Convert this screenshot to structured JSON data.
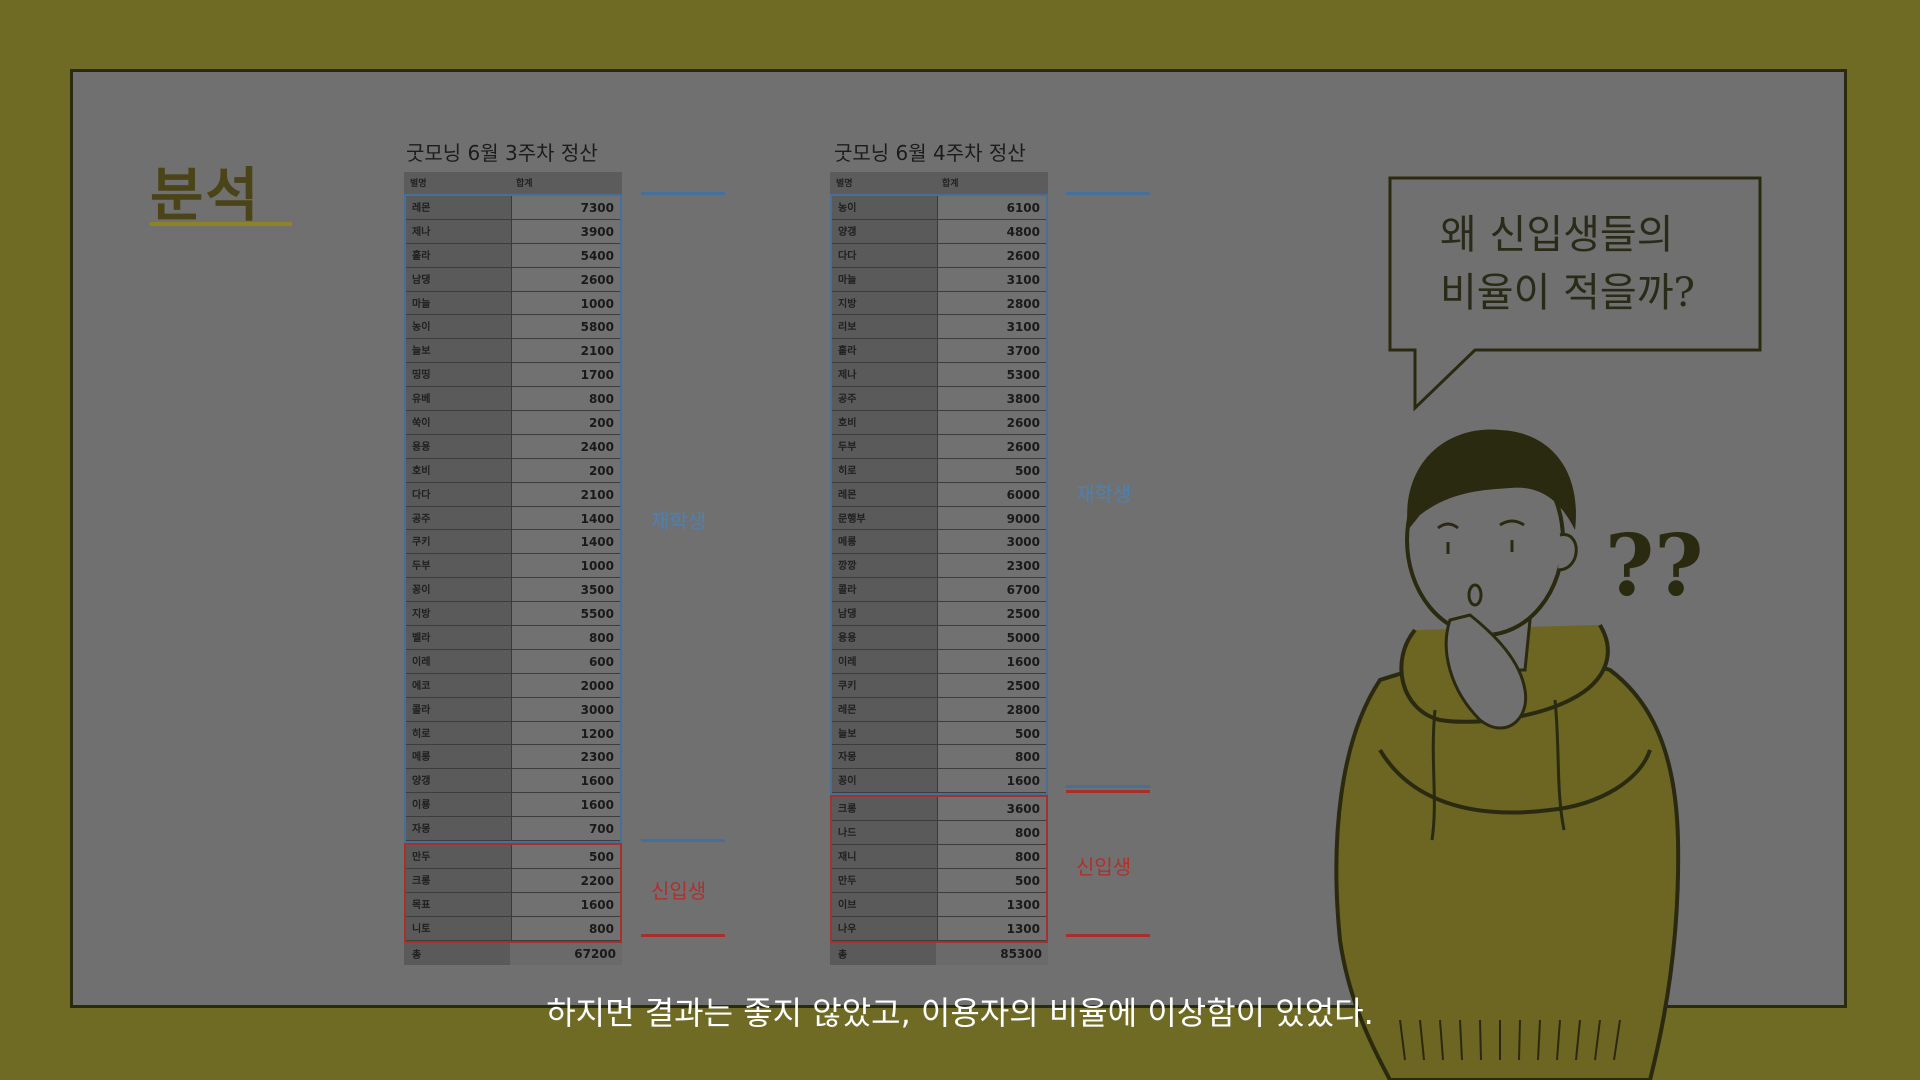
{
  "section_title": "분석",
  "tables": [
    {
      "title": "굿모닝 6월 3주차 정산",
      "header": {
        "name": "별명",
        "sum": "합계"
      },
      "returning": [
        {
          "name": "레몬",
          "value": "7300"
        },
        {
          "name": "제나",
          "value": "3900"
        },
        {
          "name": "홀라",
          "value": "5400"
        },
        {
          "name": "남댕",
          "value": "2600"
        },
        {
          "name": "마늘",
          "value": "1000"
        },
        {
          "name": "농이",
          "value": "5800"
        },
        {
          "name": "늘보",
          "value": "2100"
        },
        {
          "name": "띵띵",
          "value": "1700"
        },
        {
          "name": "유베",
          "value": "800"
        },
        {
          "name": "쑥이",
          "value": "200"
        },
        {
          "name": "용용",
          "value": "2400"
        },
        {
          "name": "호비",
          "value": "200"
        },
        {
          "name": "다다",
          "value": "2100"
        },
        {
          "name": "공주",
          "value": "1400"
        },
        {
          "name": "쿠키",
          "value": "1400"
        },
        {
          "name": "두부",
          "value": "1000"
        },
        {
          "name": "꽁이",
          "value": "3500"
        },
        {
          "name": "지방",
          "value": "5500"
        },
        {
          "name": "벨라",
          "value": "800"
        },
        {
          "name": "이레",
          "value": "600"
        },
        {
          "name": "에코",
          "value": "2000"
        },
        {
          "name": "콜라",
          "value": "3000"
        },
        {
          "name": "히로",
          "value": "1200"
        },
        {
          "name": "메롱",
          "value": "2300"
        },
        {
          "name": "양갱",
          "value": "1600"
        },
        {
          "name": "이룡",
          "value": "1600"
        },
        {
          "name": "자몽",
          "value": "700"
        }
      ],
      "new": [
        {
          "name": "만두",
          "value": "500"
        },
        {
          "name": "크롱",
          "value": "2200"
        },
        {
          "name": "목표",
          "value": "1600"
        },
        {
          "name": "니토",
          "value": "800"
        }
      ],
      "total": {
        "name": "총",
        "value": "67200"
      }
    },
    {
      "title": "굿모닝 6월 4주차 정산",
      "header": {
        "name": "별명",
        "sum": "합계"
      },
      "returning": [
        {
          "name": "농이",
          "value": "6100"
        },
        {
          "name": "양갱",
          "value": "4800"
        },
        {
          "name": "다다",
          "value": "2600"
        },
        {
          "name": "마늘",
          "value": "3100"
        },
        {
          "name": "지방",
          "value": "2800"
        },
        {
          "name": "리보",
          "value": "3100"
        },
        {
          "name": "홀라",
          "value": "3700"
        },
        {
          "name": "제나",
          "value": "5300"
        },
        {
          "name": "공주",
          "value": "3800"
        },
        {
          "name": "호비",
          "value": "2600"
        },
        {
          "name": "두부",
          "value": "2600"
        },
        {
          "name": "히로",
          "value": "500"
        },
        {
          "name": "레몬",
          "value": "6000"
        },
        {
          "name": "문행부",
          "value": "9000"
        },
        {
          "name": "메롱",
          "value": "3000"
        },
        {
          "name": "깡깡",
          "value": "2300"
        },
        {
          "name": "콜라",
          "value": "6700"
        },
        {
          "name": "남댕",
          "value": "2500"
        },
        {
          "name": "용용",
          "value": "5000"
        },
        {
          "name": "이레",
          "value": "1600"
        },
        {
          "name": "쿠키",
          "value": "2500"
        },
        {
          "name": "레몬",
          "value": "2800"
        },
        {
          "name": "늘보",
          "value": "500"
        },
        {
          "name": "자몽",
          "value": "800"
        },
        {
          "name": "꽁이",
          "value": "1600"
        }
      ],
      "new": [
        {
          "name": "크롱",
          "value": "3600"
        },
        {
          "name": "나드",
          "value": "800"
        },
        {
          "name": "재니",
          "value": "800"
        },
        {
          "name": "만두",
          "value": "500"
        },
        {
          "name": "이브",
          "value": "1300"
        },
        {
          "name": "나우",
          "value": "1300"
        }
      ],
      "total": {
        "name": "총",
        "value": "85300"
      }
    }
  ],
  "labels": {
    "returning": "재학생",
    "new": "신입생"
  },
  "bubble": {
    "line1": "왜 신입생들의",
    "line2": "비율이 적을까?"
  },
  "question_marks": "??",
  "subtitle": "하지먼 결과는 좋지 않았고, 이용자의 비율에 이상함이 있었다.",
  "colors": {
    "background": "#6f6a24",
    "slide": "#707070",
    "returning": "#46709a",
    "new": "#a8302c",
    "hoodie": "#6d6522"
  }
}
